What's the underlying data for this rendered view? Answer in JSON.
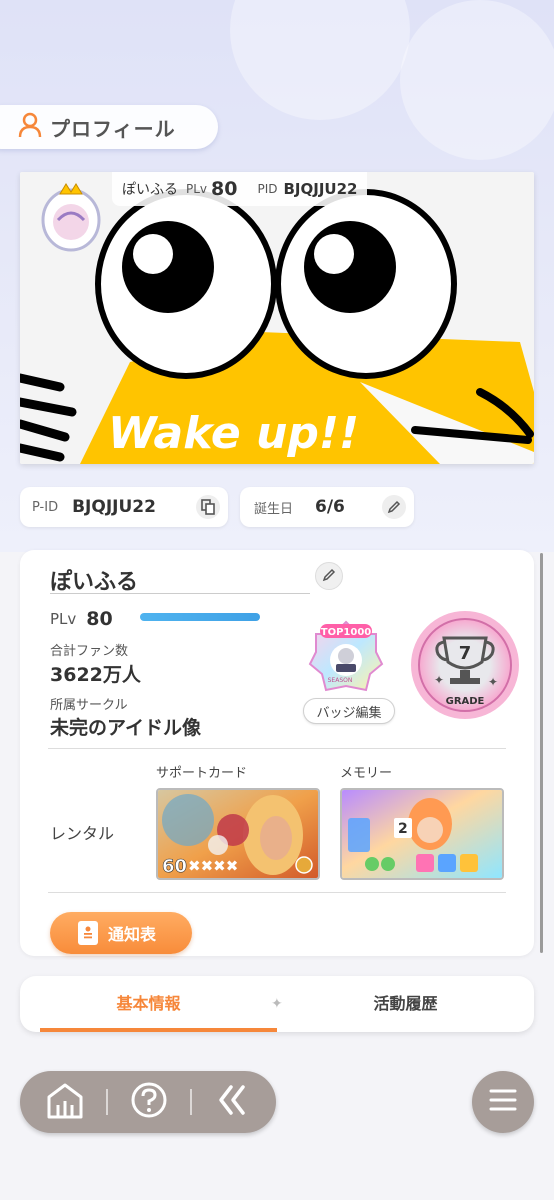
{
  "header": {
    "title": "プロフィール"
  },
  "banner": {
    "name": "ぽいふる",
    "plv_label": "PLv",
    "plv_value": "80",
    "pid_label": "PID",
    "pid_value": "BJQJJU22",
    "art_text": "Wake up!!"
  },
  "info": {
    "pid_label": "P-ID",
    "pid_value": "BJQJJU22",
    "birthday_label": "誕生日",
    "birthday_value": "6/6"
  },
  "profile": {
    "username": "ぽいふる",
    "plv_label": "PLv",
    "plv_value": "80",
    "fans_label": "合計ファン数",
    "fans_value": "3622万人",
    "circle_label": "所属サークル",
    "circle_value": "未完のアイドル像",
    "badge_edit_label": "バッジ編集",
    "top_badge_text": "TOP1000",
    "top_badge_season": "SEASON",
    "grade_value": "7",
    "grade_label": "GRADE"
  },
  "rental": {
    "label": "レンタル",
    "support_card_label": "サポートカード",
    "memory_label": "メモリー",
    "support_card_level": "60",
    "memory_rank": "2"
  },
  "notice_button": {
    "label": "通知表"
  },
  "tabs": [
    {
      "label": "基本情報",
      "active": true
    },
    {
      "label": "活動履歴",
      "active": false
    }
  ],
  "colors": {
    "accent": "#f6873a",
    "xp_bar": "#4fb3ef",
    "nav": "#a79d99"
  },
  "icons": [
    "user-icon",
    "copy-icon",
    "pencil-icon",
    "home-icon",
    "help-icon",
    "back-icon",
    "menu-icon"
  ]
}
